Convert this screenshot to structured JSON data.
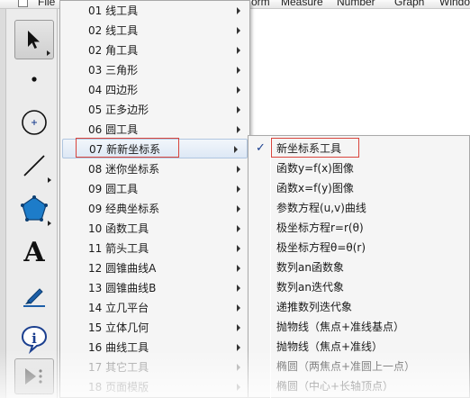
{
  "menubar": {
    "items": [
      "File",
      "orm",
      "Measure",
      "Number",
      "Graph",
      "Windo"
    ]
  },
  "toolbox": {
    "tools": [
      {
        "name": "arrow-tool-icon"
      },
      {
        "name": "point-tool-icon"
      },
      {
        "name": "compass-tool-icon"
      },
      {
        "name": "straightedge-tool-icon"
      },
      {
        "name": "polygon-tool-icon"
      },
      {
        "name": "text-tool-icon",
        "glyph": "A"
      },
      {
        "name": "marker-tool-icon"
      },
      {
        "name": "information-tool-icon",
        "glyph": "i"
      },
      {
        "name": "custom-tool-icon"
      }
    ]
  },
  "menu": {
    "items": [
      {
        "label": "01 线工具"
      },
      {
        "label": "02 线工具"
      },
      {
        "label": "02 角工具"
      },
      {
        "label": "03 三角形"
      },
      {
        "label": "04 四边形"
      },
      {
        "label": "05 正多边形"
      },
      {
        "label": "06 圆工具"
      },
      {
        "label": "07 新新坐标系"
      },
      {
        "label": "08 迷你坐标系"
      },
      {
        "label": "09 圆工具"
      },
      {
        "label": "09 经典坐标系"
      },
      {
        "label": "10 函数工具"
      },
      {
        "label": "11 箭头工具"
      },
      {
        "label": "12 圆锥曲线A"
      },
      {
        "label": "13 圆锥曲线B"
      },
      {
        "label": "14 立几平台"
      },
      {
        "label": "15 立体几何"
      },
      {
        "label": "16 曲线工具"
      },
      {
        "label": "17 其它工具"
      },
      {
        "label": "18 页面模版"
      }
    ]
  },
  "submenu": {
    "check": "✓",
    "items": [
      {
        "label": "新坐标系工具"
      },
      {
        "label": "函数y=f(x)图像"
      },
      {
        "label": "函数x=f(y)图像"
      },
      {
        "label": "参数方程(u,v)曲线"
      },
      {
        "label": "极坐标方程r=r(θ)"
      },
      {
        "label": "极坐标方程θ=θ(r)"
      },
      {
        "label": "数列an函数象"
      },
      {
        "label": "数列an迭代象"
      },
      {
        "label": "递推数列迭代象"
      },
      {
        "label": "抛物线（焦点+准线基点）"
      },
      {
        "label": "抛物线（焦点+准线）"
      },
      {
        "label": "椭圆（两焦点+准圆上一点）"
      },
      {
        "label": "椭圆（中心+长轴顶点）"
      }
    ]
  },
  "colors": {
    "annotation_border": "#d9443c",
    "check_color": "#1b3f8f"
  }
}
